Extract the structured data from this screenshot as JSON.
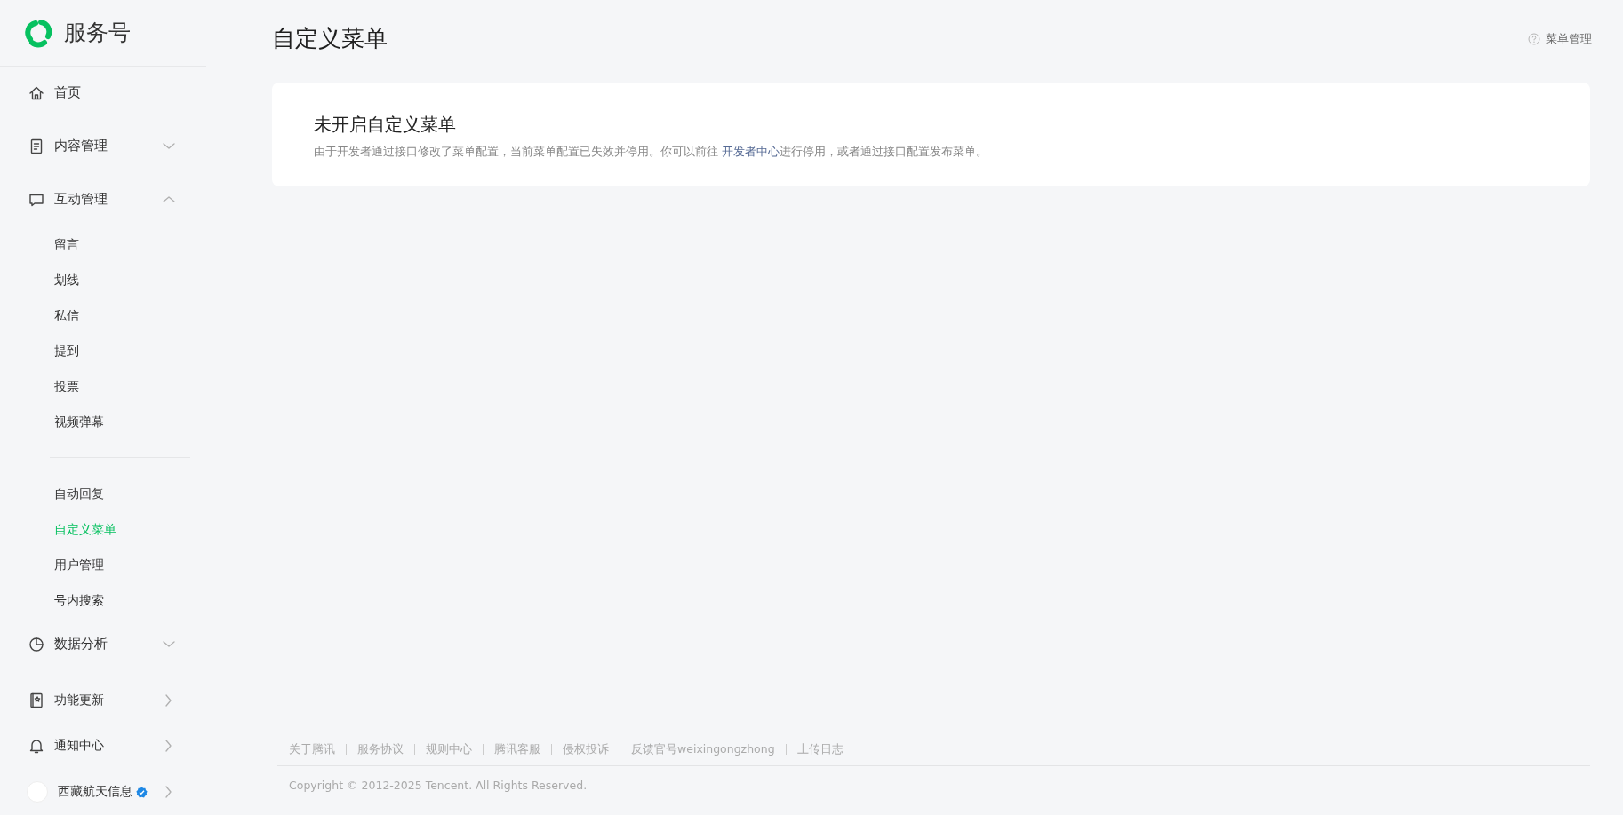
{
  "sidebar": {
    "logo": {
      "text": "服务号"
    },
    "nav": [
      {
        "kind": "link",
        "label": "首页"
      },
      {
        "kind": "group",
        "label": "内容管理",
        "expanded": false
      },
      {
        "kind": "group",
        "label": "互动管理",
        "expanded": true,
        "sections": [
          {
            "children": [
              {
                "label": "留言",
                "selected": false
              },
              {
                "label": "划线",
                "selected": false
              },
              {
                "label": "私信",
                "selected": false
              },
              {
                "label": "提到",
                "selected": false
              },
              {
                "label": "投票",
                "selected": false
              },
              {
                "label": "视频弹幕",
                "selected": false
              }
            ]
          },
          {
            "children": [
              {
                "label": "自动回复",
                "selected": false
              },
              {
                "label": "自定义菜单",
                "selected": true
              },
              {
                "label": "用户管理",
                "selected": false
              },
              {
                "label": "号内搜索",
                "selected": false
              }
            ]
          }
        ]
      },
      {
        "kind": "group",
        "label": "数据分析",
        "expanded": false
      }
    ],
    "bottom": [
      {
        "kind": "link",
        "label": "功能更新"
      },
      {
        "kind": "link",
        "label": "通知中心"
      },
      {
        "kind": "account",
        "label": "西藏航天信息",
        "verified": true
      }
    ]
  },
  "page": {
    "title": "自定义菜单",
    "help_link": "菜单管理",
    "notice": {
      "title": "未开启自定义菜单",
      "text_before": "由于开发者通过接口修改了菜单配置，当前菜单配置已失效并停用。你可以前往 ",
      "link": "开发者中心",
      "text_after": "进行停用，或者通过接口配置发布菜单。"
    }
  },
  "footer": {
    "links": [
      "关于腾讯",
      "服务协议",
      "规则中心",
      "腾讯客服",
      "侵权投诉",
      "反馈官号weixingongzhong",
      "上传日志"
    ],
    "copyright": "Copyright © 2012-2025 Tencent. All Rights Reserved."
  }
}
